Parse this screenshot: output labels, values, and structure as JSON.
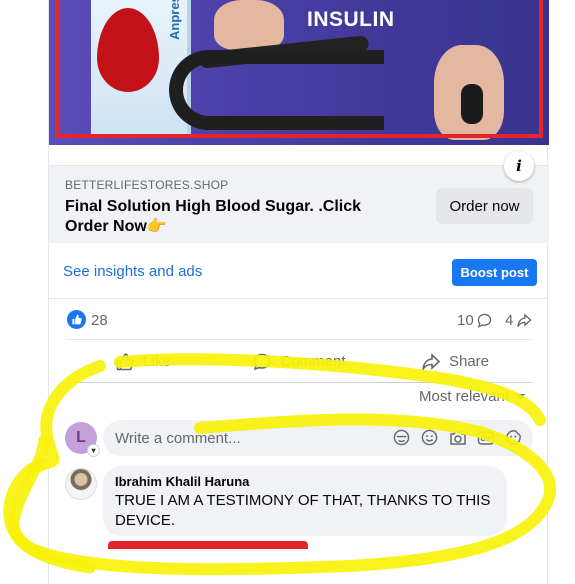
{
  "ad": {
    "headline": "INSULIN",
    "box_brand": "Anpresure",
    "info_icon": "info-icon",
    "domain": "BETTERLIFESTORES.SHOP",
    "title": "Final Solution High Blood Sugar. .Click Order Now👉",
    "cta_label": "Order now"
  },
  "insights": {
    "link_label": "See insights and ads",
    "boost_label": "Boost post"
  },
  "stats": {
    "likes": "28",
    "comments": "10",
    "shares": "4"
  },
  "actions": {
    "like": "Like",
    "comment": "Comment",
    "share": "Share"
  },
  "sort": {
    "label": "Most relevant"
  },
  "composer": {
    "avatar_letter": "L",
    "placeholder": "Write a comment..."
  },
  "comments": [
    {
      "author": "Ibrahim Khalil Haruna",
      "text": "TRUE I AM A TESTIMONY OF THAT, THANKS TO THIS DEVICE."
    }
  ],
  "colors": {
    "accent": "#1877f2",
    "link": "#216fdb",
    "highlight": "#f7f20a",
    "ad_border": "#e3242b"
  }
}
